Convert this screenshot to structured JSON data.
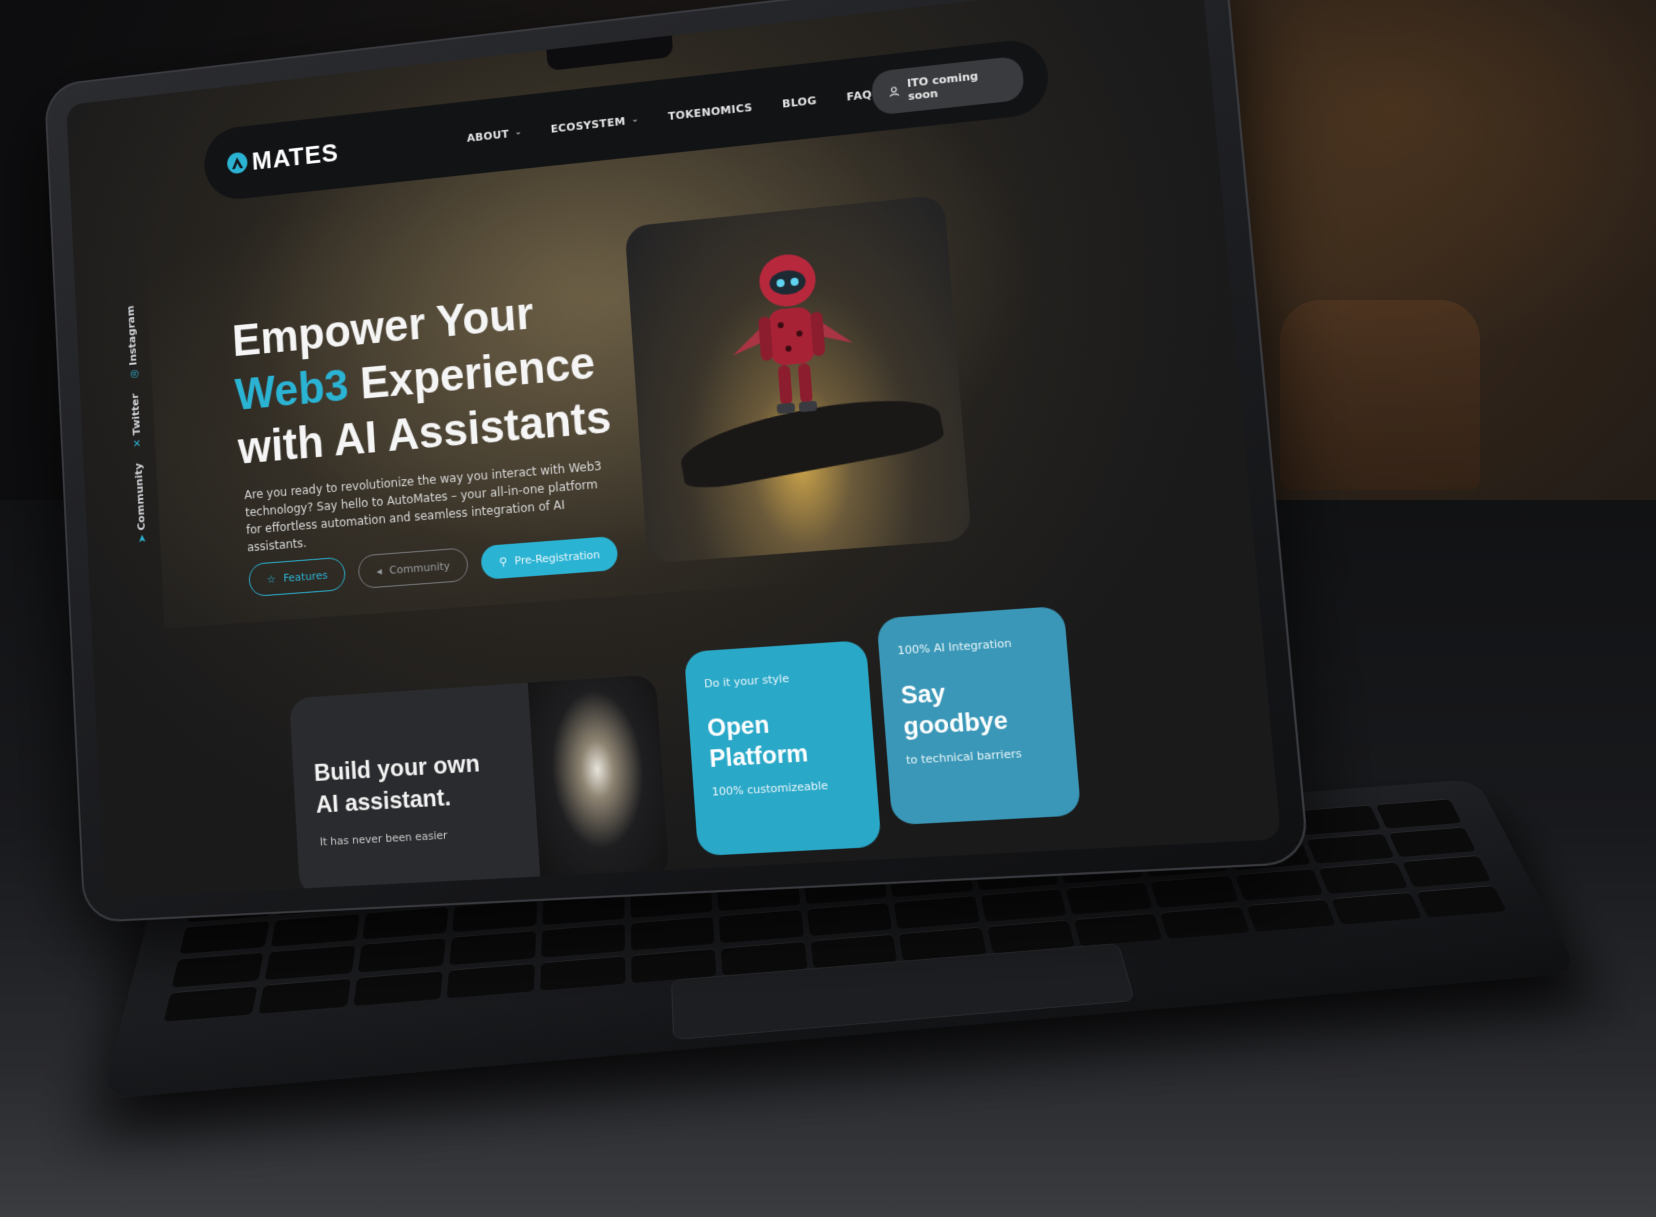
{
  "nav": {
    "logo": "MATES",
    "items": [
      {
        "label": "ABOUT",
        "dropdown": true
      },
      {
        "label": "ECOSYSTEM",
        "dropdown": true
      },
      {
        "label": "TOKENOMICS",
        "dropdown": false
      },
      {
        "label": "BLOG",
        "dropdown": false
      },
      {
        "label": "FAQ",
        "dropdown": false
      }
    ],
    "cta": "ITO coming soon"
  },
  "socials": [
    "Community",
    "Twitter",
    "Instagram"
  ],
  "hero": {
    "line1": "Empower Your",
    "line2_accent": "Web3",
    "line2_rest": " Experience",
    "line3": "with AI Assistants",
    "text": "Are you ready to revolutionize the way you interact with Web3 technology? Say hello to AutoMates – your all-in-one platform for effortless automation and seamless integration of AI assistants.",
    "buttons": {
      "features": "Features",
      "community": "Community",
      "preregistration": "Pre-Registration"
    }
  },
  "cards": {
    "build": {
      "title_line1": "Build your own",
      "title_line2": "AI assistant.",
      "sub": "It has never been easier"
    },
    "open": {
      "eyebrow": "Do it your style",
      "title_line1": "Open",
      "title_line2": "Platform",
      "sub": "100% customizeable"
    },
    "say": {
      "eyebrow": "100% AI Integration",
      "title_line1": "Say",
      "title_line2": "goodbye",
      "sub": "to technical barriers"
    }
  },
  "colors": {
    "accent": "#2bb3d4",
    "background": "#1a1a1b"
  }
}
